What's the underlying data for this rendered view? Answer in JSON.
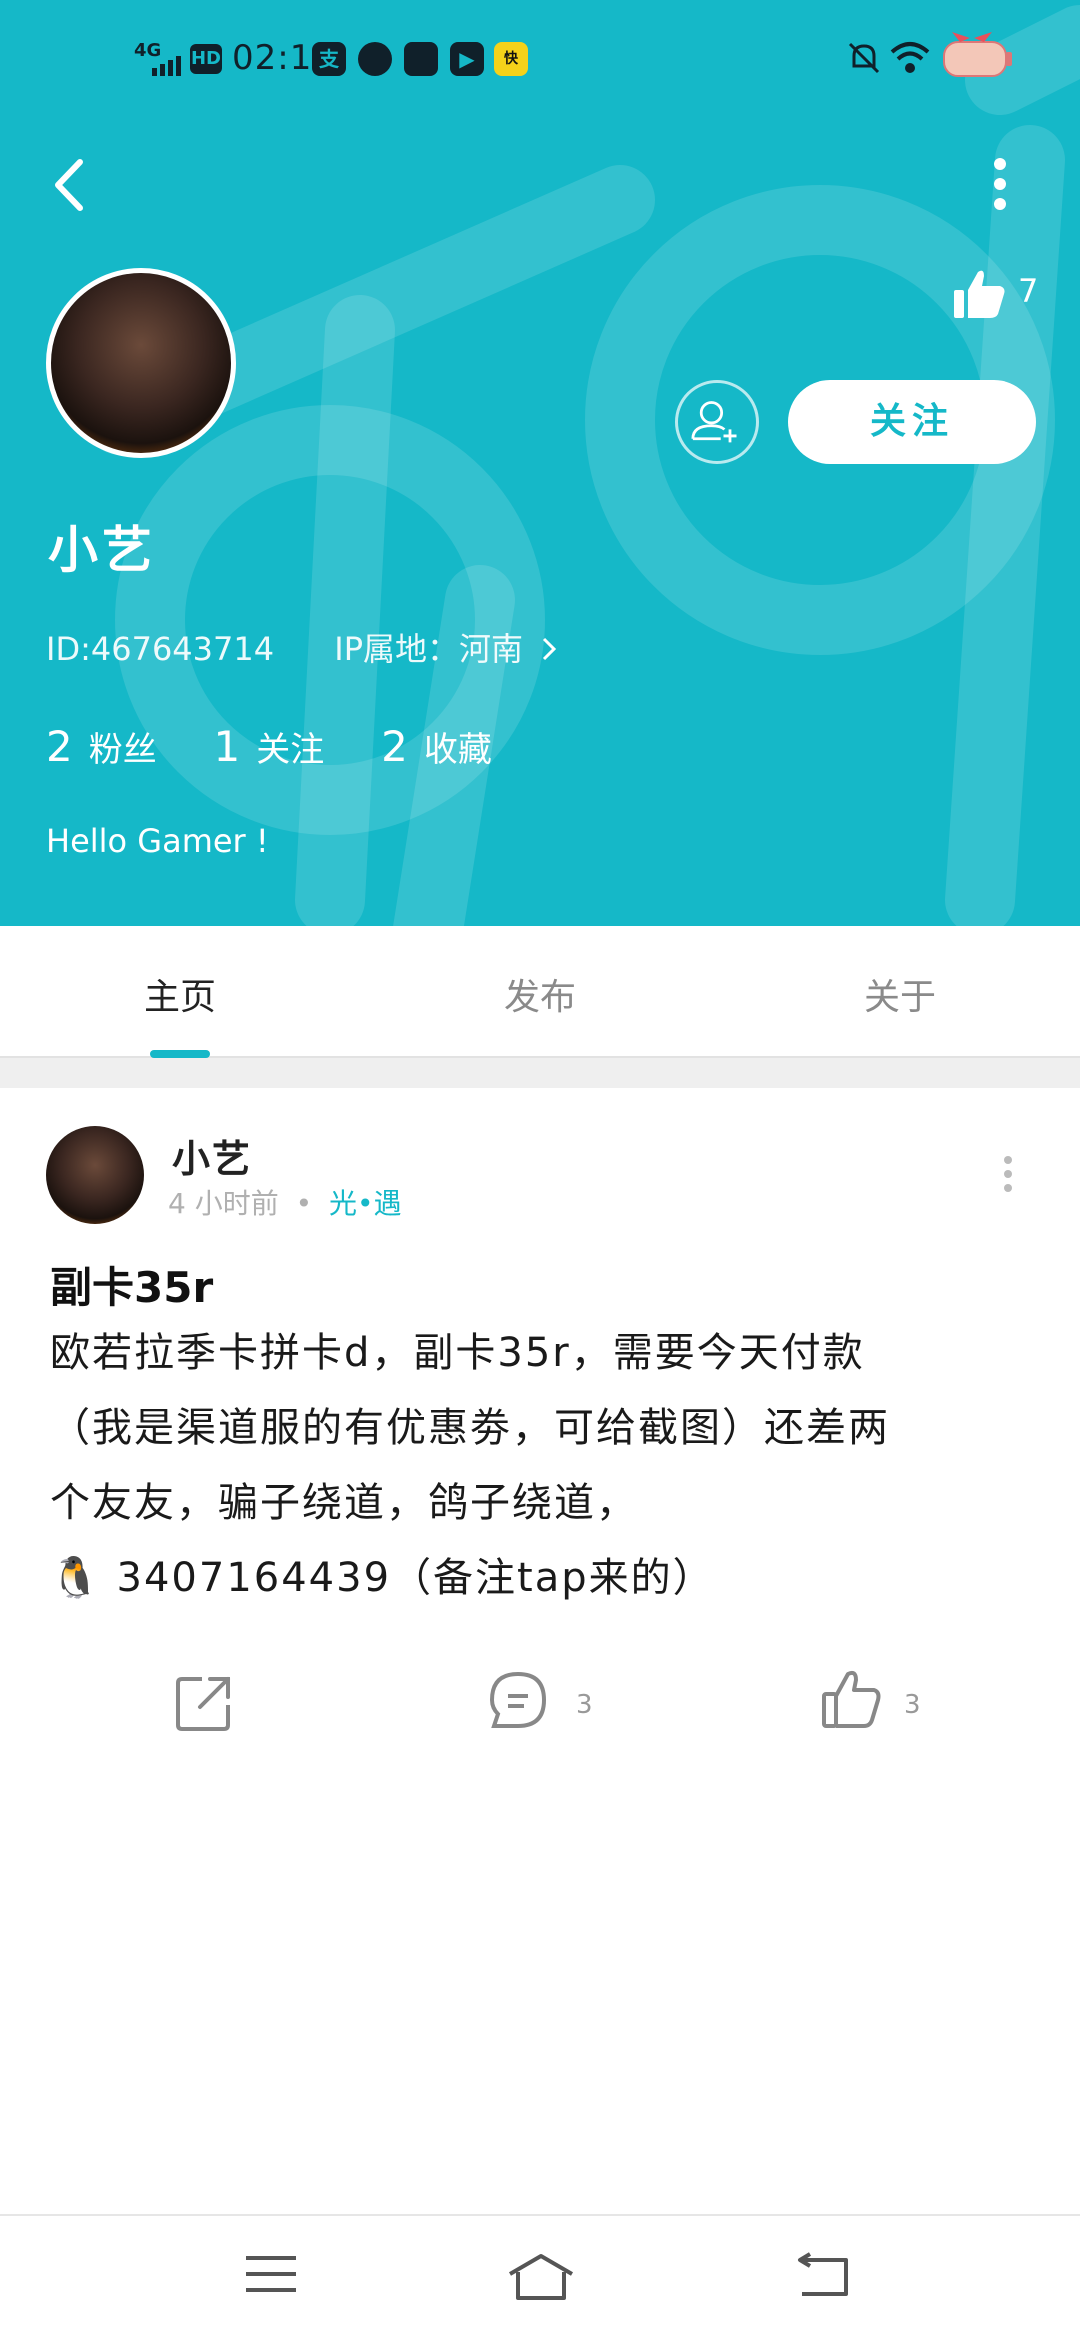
{
  "status_bar": {
    "network": "4G",
    "hd": "HD",
    "time": "02:13"
  },
  "profile": {
    "name": "小艺",
    "id": "ID:467643714",
    "ip_location": "IP属地：河南",
    "likes": "7",
    "follow_label": "关注",
    "fans_count": "2",
    "fans_label": "粉丝",
    "following_count": "1",
    "following_label": "关注",
    "favorites_count": "2",
    "favorites_label": "收藏",
    "bio": "Hello Gamer !"
  },
  "tabs": [
    {
      "label": "主页",
      "active": true
    },
    {
      "label": "发布",
      "active": false
    },
    {
      "label": "关于",
      "active": false
    }
  ],
  "post": {
    "author": "小艺",
    "time": "4 小时前",
    "separator": "•",
    "game": "光•遇",
    "title": "副卡35r",
    "lines": [
      "欧若拉季卡拼卡d，副卡35r，需要今天付款",
      "（我是渠道服的有优惠劵，可给截图）还差两",
      "个友友，骗子绕道，鸽子绕道，",
      "🐧 3407164439（备注tap来的）"
    ],
    "comments": "3",
    "likes": "3"
  },
  "colors": {
    "accent": "#15b8c8",
    "header_bg": "#15b8c8",
    "text_muted": "#b0b0b0"
  }
}
